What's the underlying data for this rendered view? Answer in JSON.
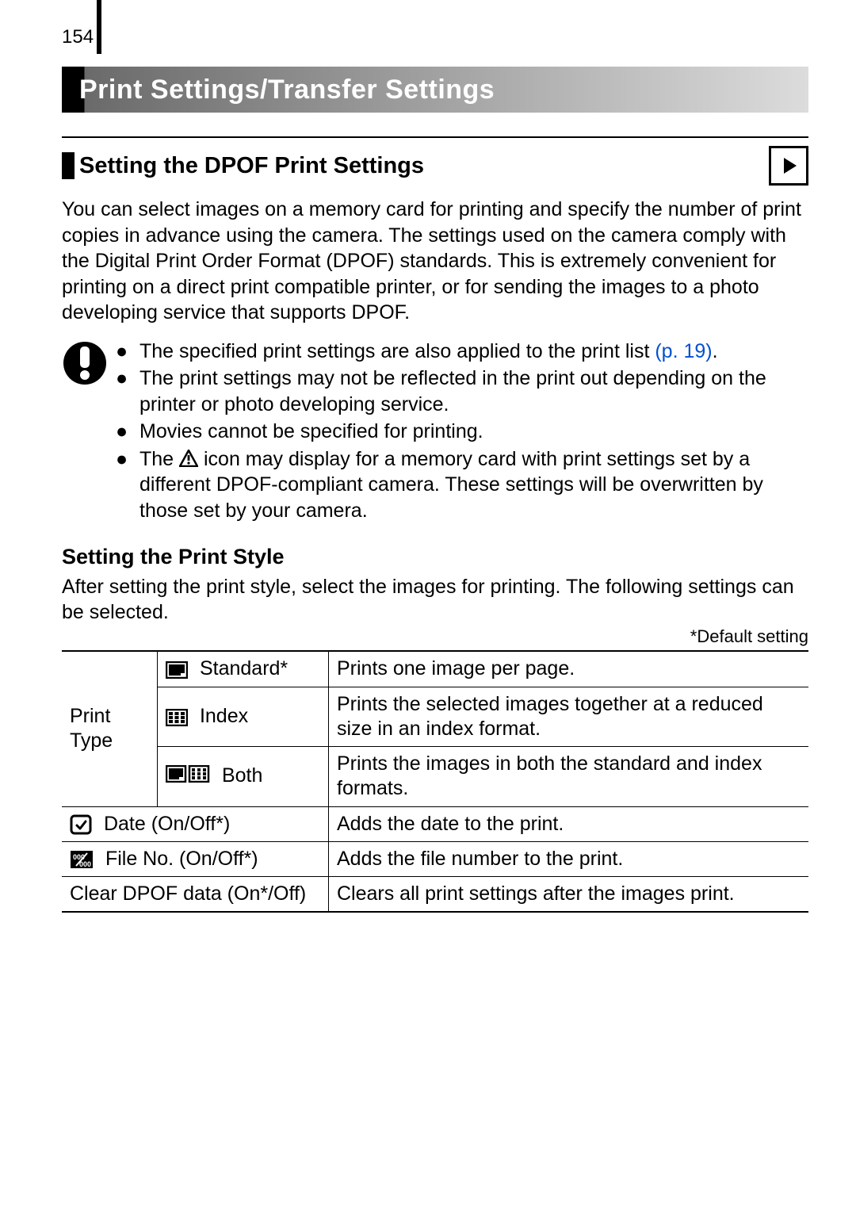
{
  "page_number": "154",
  "title": "Print Settings/Transfer Settings",
  "section_heading": "Setting the DPOF Print Settings",
  "intro_text": "You can select images on a memory card for printing and specify the number of print copies in advance using the camera. The settings used on the camera comply with the Digital Print Order Format (DPOF) standards. This is extremely convenient for printing on a direct print compatible printer, or for sending the images to a photo developing service that supports DPOF.",
  "notes": {
    "n1a": "The specified print settings are also applied to the print list ",
    "n1_link": "(p. 19)",
    "n1b": ".",
    "n2": "The print settings may not be reflected in the print out depending on the printer or photo developing service.",
    "n3": "Movies cannot be specified for printing.",
    "n4a": "The ",
    "n4b": " icon may display for a memory card with print settings set by a different DPOF-compliant camera. These settings will be overwritten by those set by your camera."
  },
  "sub2_heading": "Setting the Print Style",
  "sub2_text": "After setting the print style, select the images for printing. The following settings can be selected.",
  "default_note": "*Default setting",
  "table": {
    "print_type_label": "Print Type",
    "standard_label": "Standard*",
    "standard_desc": "Prints one image per page.",
    "index_label": "Index",
    "index_desc": "Prints the selected images together at a reduced size in an index format.",
    "both_label": "Both",
    "both_desc": "Prints the images in both the standard and index formats.",
    "date_label": "Date (On/Off*)",
    "date_desc": "Adds the date to the print.",
    "fileno_label": "File No. (On/Off*)",
    "fileno_desc": "Adds the file number to the print.",
    "clear_label": "Clear DPOF data (On*/Off)",
    "clear_desc": "Clears all print settings after the images print."
  }
}
